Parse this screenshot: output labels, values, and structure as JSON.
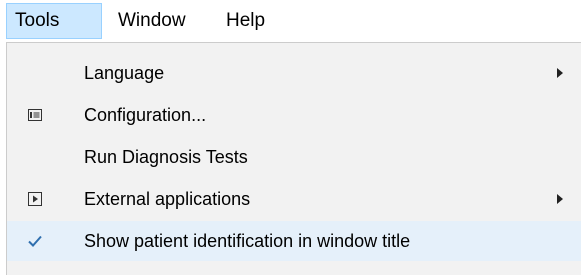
{
  "menubar": {
    "items": [
      {
        "label": "Tools"
      },
      {
        "label": "Window"
      },
      {
        "label": "Help"
      }
    ]
  },
  "tools_menu": {
    "items": [
      {
        "label": "Language",
        "icon": "none",
        "has_submenu": true
      },
      {
        "label": "Configuration...",
        "icon": "configuration-icon",
        "has_submenu": false
      },
      {
        "label": "Run Diagnosis Tests",
        "icon": "none",
        "has_submenu": false
      },
      {
        "label": "External applications",
        "icon": "run-icon",
        "has_submenu": true
      },
      {
        "label": "Show patient identification in window title",
        "icon": "checkmark-icon",
        "checked": true,
        "has_submenu": false
      }
    ]
  },
  "colors": {
    "active_menu_bg": "#cce8ff",
    "active_menu_border": "#99d1ff",
    "dropdown_bg": "#f2f2f2",
    "checked_row_bg": "#e5f0fa",
    "checkmark": "#2f6fae"
  }
}
